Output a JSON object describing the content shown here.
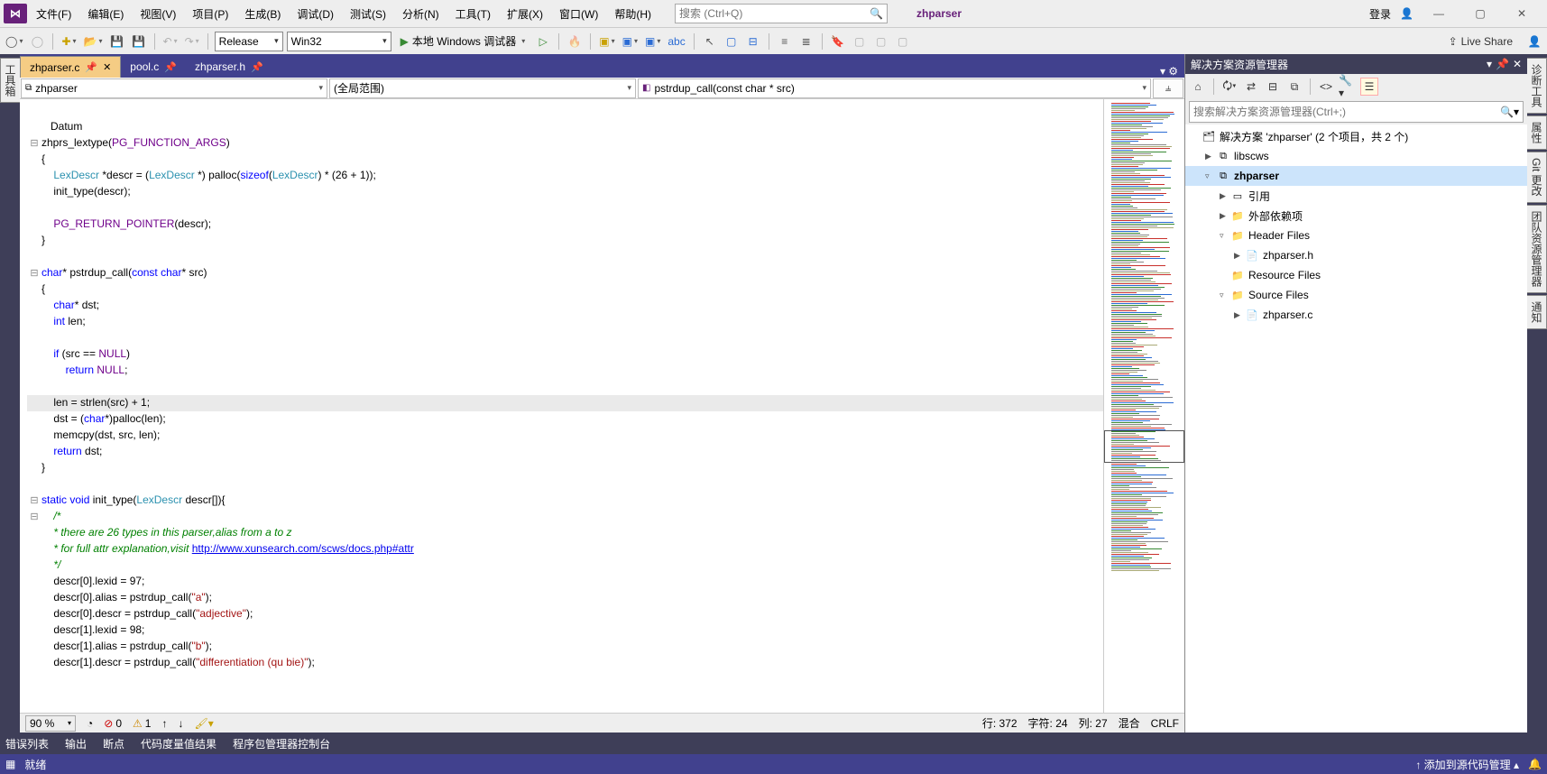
{
  "menu": {
    "items": [
      "文件(F)",
      "编辑(E)",
      "视图(V)",
      "项目(P)",
      "生成(B)",
      "调试(D)",
      "测试(S)",
      "分析(N)",
      "工具(T)",
      "扩展(X)",
      "窗口(W)",
      "帮助(H)"
    ]
  },
  "title": {
    "search_placeholder": "搜索 (Ctrl+Q)",
    "app": "zhparser",
    "signin": "登录"
  },
  "toolbar": {
    "config": "Release",
    "platform": "Win32",
    "debugger": "本地 Windows 调试器",
    "liveshare": "Live Share"
  },
  "left_rail": [
    "工具箱"
  ],
  "right_rail": [
    "诊断工具",
    "属性",
    "Git 更改",
    "团队资源管理器",
    "通知"
  ],
  "tabs": [
    {
      "name": "zhparser.c",
      "active": true,
      "pinned": true
    },
    {
      "name": "pool.c",
      "active": false,
      "pinned": true
    },
    {
      "name": "zhparser.h",
      "active": false,
      "pinned": true
    }
  ],
  "nav": {
    "scope": "zhparser",
    "class": "(全局范围)",
    "func": "pstrdup_call(const char * src)"
  },
  "code": {
    "lines": [
      {
        "t": "",
        "o": " "
      },
      {
        "t": "   Datum",
        "o": " ",
        "cls": "tp"
      },
      {
        "t": "zhprs_lextype(PG_FUNCTION_ARGS)",
        "o": "-",
        "raw": "<span class='fn'>zhprs_lextype</span>(<span class='mc'>PG_FUNCTION_ARGS</span>)"
      },
      {
        "t": "{",
        "o": " "
      },
      {
        "t": "    LexDescr *descr = (LexDescr *) palloc(sizeof(LexDescr) * (26 + 1));",
        "o": " ",
        "raw": "    <span class='tp'>LexDescr</span> *descr = (<span class='tp'>LexDescr</span> *) <span class='fn'>palloc</span>(<span class='kw'>sizeof</span>(<span class='tp'>LexDescr</span>) * (26 + 1));"
      },
      {
        "t": "    init_type(descr);",
        "o": " ",
        "raw": "    <span class='fn'>init_type</span>(descr);"
      },
      {
        "t": "",
        "o": " "
      },
      {
        "t": "    PG_RETURN_POINTER(descr);",
        "o": " ",
        "raw": "    <span class='mc'>PG_RETURN_POINTER</span>(descr);"
      },
      {
        "t": "}",
        "o": " "
      },
      {
        "t": "",
        "o": " "
      },
      {
        "t": "char* pstrdup_call(const char* src)",
        "o": "-",
        "raw": "<span class='kw'>char</span>* <span class='fn'>pstrdup_call</span>(<span class='kw'>const</span> <span class='kw'>char</span>* src)"
      },
      {
        "t": "{",
        "o": " "
      },
      {
        "t": "    char* dst;",
        "o": " ",
        "raw": "    <span class='kw'>char</span>* dst;"
      },
      {
        "t": "    int len;",
        "o": " ",
        "raw": "    <span class='kw'>int</span> len;"
      },
      {
        "t": "",
        "o": " "
      },
      {
        "t": "    if (src == NULL)",
        "o": " ",
        "raw": "    <span class='kw'>if</span> (src == <span class='mc'>NULL</span>)"
      },
      {
        "t": "        return NULL;",
        "o": " ",
        "raw": "        <span class='kw'>return</span> <span class='mc'>NULL</span>;"
      },
      {
        "t": "",
        "o": " "
      },
      {
        "t": "    len = strlen(src) + 1;",
        "o": " ",
        "hl": true,
        "raw": "    len = <span class='fn'>strlen</span>(src) + 1;"
      },
      {
        "t": "    dst = (char*)palloc(len);",
        "o": " ",
        "raw": "    dst = (<span class='kw'>char</span>*)<span class='fn'>palloc</span>(len);"
      },
      {
        "t": "    memcpy(dst, src, len);",
        "o": " ",
        "raw": "    <span class='fn'>memcpy</span>(dst, src, len);"
      },
      {
        "t": "    return dst;",
        "o": " ",
        "raw": "    <span class='kw'>return</span> dst;"
      },
      {
        "t": "}",
        "o": " "
      },
      {
        "t": "",
        "o": " "
      },
      {
        "t": "static void init_type(LexDescr descr[]){",
        "o": "-",
        "raw": "<span class='kw'>static</span> <span class='kw'>void</span> <span class='fn'>init_type</span>(<span class='tp'>LexDescr</span> descr[]){"
      },
      {
        "t": "    /*",
        "o": "-",
        "raw": "    <span class='cm'>/*</span>"
      },
      {
        "t": "    * there are 26 types in this parser,alias from a to z",
        "o": " ",
        "raw": "    <span class='cm'>* there are 26 types in this parser,alias from a to z</span>"
      },
      {
        "t": "    * for full attr explanation,visit http://www.xunsearch.com/scws/docs.php#attr",
        "o": " ",
        "raw": "    <span class='cm'>* for full attr explanation,visit </span><span class='lk'>http://www.xunsearch.com/scws/docs.php#attr</span>"
      },
      {
        "t": "    */",
        "o": " ",
        "raw": "    <span class='cm'>*/</span>"
      },
      {
        "t": "    descr[0].lexid = 97;",
        "o": " ",
        "raw": "    descr[0].lexid = 97;"
      },
      {
        "t": "    descr[0].alias = pstrdup_call(\"a\");",
        "o": " ",
        "raw": "    descr[0].alias = <span class='fn'>pstrdup_call</span>(<span class='st'>\"a\"</span>);"
      },
      {
        "t": "    descr[0].descr = pstrdup_call(\"adjective\");",
        "o": " ",
        "raw": "    descr[0].descr = <span class='fn'>pstrdup_call</span>(<span class='st'>\"adjective\"</span>);"
      },
      {
        "t": "    descr[1].lexid = 98;",
        "o": " ",
        "raw": "    descr[1].lexid = 98;"
      },
      {
        "t": "    descr[1].alias = pstrdup_call(\"b\");",
        "o": " ",
        "raw": "    descr[1].alias = <span class='fn'>pstrdup_call</span>(<span class='st'>\"b\"</span>);"
      },
      {
        "t": "    descr[1].descr = pstrdup_call(\"differentiation (qu bie)\");",
        "o": " ",
        "raw": "    descr[1].descr = <span class='fn'>pstrdup_call</span>(<span class='st'>\"differentiation (qu bie)\"</span>);"
      }
    ]
  },
  "code_status": {
    "zoom": "90 %",
    "errors": "0",
    "warnings": "1",
    "line_label": "行:",
    "line": "372",
    "char_label": "字符:",
    "char": "24",
    "col_label": "列:",
    "col": "27",
    "mix": "混合",
    "eol": "CRLF"
  },
  "solution": {
    "title": "解决方案资源管理器",
    "search_placeholder": "搜索解决方案资源管理器(Ctrl+;)",
    "nodes": [
      {
        "d": 0,
        "exp": "",
        "icon": "🗂",
        "l": "解决方案 'zhparser' (2 个项目，共 2 个)"
      },
      {
        "d": 1,
        "exp": "▶",
        "icon": "⧉",
        "l": "libscws"
      },
      {
        "d": 1,
        "exp": "▿",
        "icon": "⧉",
        "l": "zhparser",
        "sel": true,
        "bold": true
      },
      {
        "d": 2,
        "exp": "▶",
        "icon": "▭",
        "l": "引用"
      },
      {
        "d": 2,
        "exp": "▶",
        "icon": "📁",
        "l": "外部依赖项"
      },
      {
        "d": 2,
        "exp": "▿",
        "icon": "📁",
        "l": "Header Files"
      },
      {
        "d": 3,
        "exp": "▶",
        "icon": "📄",
        "l": "zhparser.h"
      },
      {
        "d": 2,
        "exp": "",
        "icon": "📁",
        "l": "Resource Files"
      },
      {
        "d": 2,
        "exp": "▿",
        "icon": "📁",
        "l": "Source Files"
      },
      {
        "d": 3,
        "exp": "▶",
        "icon": "📄",
        "l": "zhparser.c"
      }
    ]
  },
  "bottom_tabs": [
    "错误列表",
    "输出",
    "断点",
    "代码度量值结果",
    "程序包管理器控制台"
  ],
  "status": {
    "ready": "就绪",
    "scm": "添加到源代码管理"
  }
}
